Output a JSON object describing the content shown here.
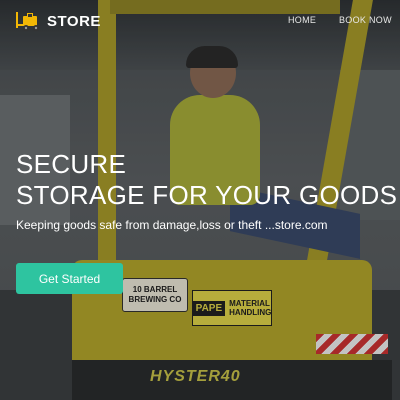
{
  "nav": {
    "brand": "STORE",
    "logo_icon": "forklift-icon",
    "links": [
      {
        "label": "HOME"
      },
      {
        "label": "BOOK NOW"
      }
    ]
  },
  "hero": {
    "title_line1": "SECURE",
    "title_line2": "STORAGE FOR YOUR GOODS",
    "tagline": "Keeping goods safe from damage,loss or theft ...store.com",
    "cta_label": "Get Started"
  },
  "photo": {
    "sign_label": "10 BARREL BREWING CO",
    "sign_pape": "PAPE",
    "sign_pape_sub": "MATERIAL HANDLING",
    "forklift_brand": "HYSTER40"
  },
  "colors": {
    "accent": "#2ec4a0",
    "text": "#ffffff"
  }
}
